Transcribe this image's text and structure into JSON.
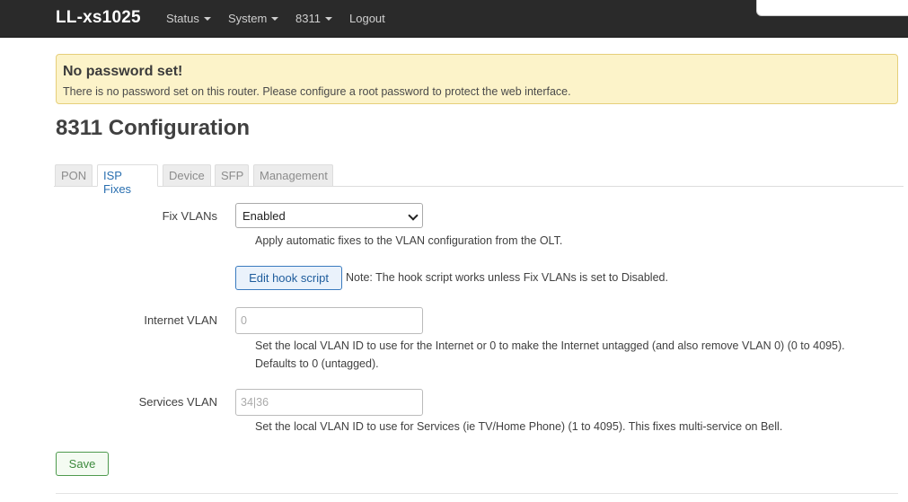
{
  "navbar": {
    "brand": "LL-xs1025",
    "menu": [
      {
        "label": "Status",
        "has_caret": true
      },
      {
        "label": "System",
        "has_caret": true
      },
      {
        "label": "8311",
        "has_caret": true
      },
      {
        "label": "Logout",
        "has_caret": false
      }
    ]
  },
  "alert": {
    "title": "No password set!",
    "text": "There is no password set on this router. Please configure a root password to protect the web interface."
  },
  "page": {
    "title": "8311 Configuration",
    "tabs": [
      {
        "label": "PON",
        "active": false
      },
      {
        "label": "ISP Fixes",
        "active": true
      },
      {
        "label": "Device",
        "active": false
      },
      {
        "label": "SFP",
        "active": false
      },
      {
        "label": "Management",
        "active": false
      }
    ]
  },
  "form": {
    "fix_vlans": {
      "label": "Fix VLANs",
      "value": "Enabled",
      "help": "Apply automatic fixes to the VLAN configuration from the OLT."
    },
    "hook": {
      "button_label": "Edit hook script",
      "note": "Note: The hook script works unless Fix VLANs is set to Disabled."
    },
    "internet_vlan": {
      "label": "Internet VLAN",
      "placeholder": "0",
      "help_line1": "Set the local VLAN ID to use for the Internet or 0 to make the Internet untagged (and also remove VLAN 0) (0 to 4095).",
      "help_line2": "Defaults to 0 (untagged)."
    },
    "services_vlan": {
      "label": "Services VLAN",
      "placeholder": "34|36",
      "help": "Set the local VLAN ID to use for Services (ie TV/Home Phone) (1 to 4095). This fixes multi-service on Bell."
    },
    "save_label": "Save"
  }
}
